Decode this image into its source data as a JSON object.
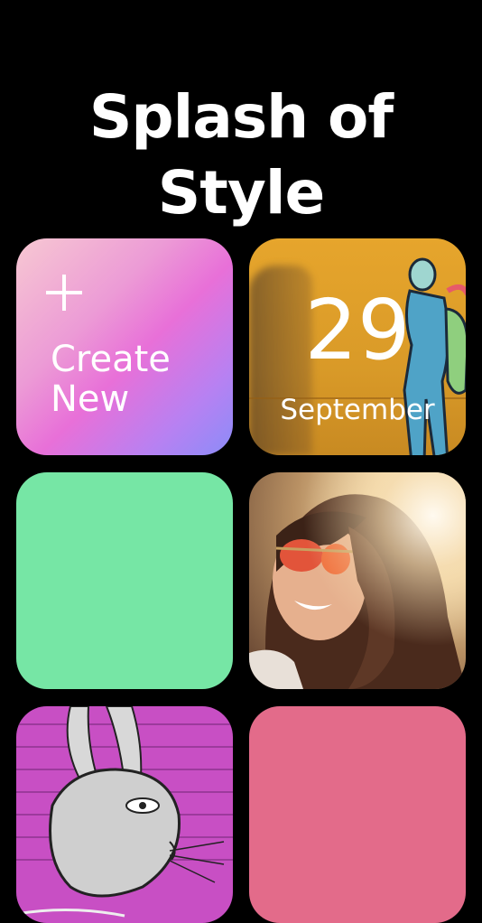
{
  "header": {
    "title": "Splash of Style"
  },
  "tiles": {
    "create": {
      "line1": "Create",
      "line2": "New",
      "gradient_colors": [
        "#f7c8d2",
        "#e870d8",
        "#8b8cf8"
      ]
    },
    "date": {
      "day": "29",
      "month": "September",
      "background_color": "#e6a52c"
    },
    "solid_green": {
      "color": "#76e6a5"
    },
    "portrait_photo": {
      "subject": "smiling woman with sunglasses"
    },
    "rabbit_photo": {
      "subject": "rabbit street art on pink brick wall",
      "color": "#c84fc4"
    },
    "solid_pink": {
      "color": "#e36b8a"
    }
  }
}
